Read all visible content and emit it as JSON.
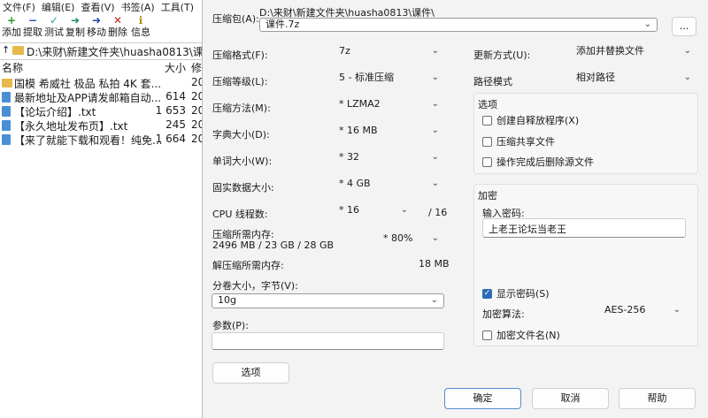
{
  "filemanager": {
    "menu": [
      "文件(F)",
      "编辑(E)",
      "查看(V)",
      "书签(A)",
      "工具(T)"
    ],
    "toolbar": [
      {
        "icon": "+",
        "label": "添加",
        "name": "add"
      },
      {
        "icon": "−",
        "label": "提取",
        "name": "extract"
      },
      {
        "icon": "✓",
        "label": "测试",
        "name": "test"
      },
      {
        "icon": "➜",
        "label": "复制",
        "name": "copy"
      },
      {
        "icon": "➜",
        "label": "移动",
        "name": "move"
      },
      {
        "icon": "✕",
        "label": "删除",
        "name": "delete"
      },
      {
        "icon": "ℹ",
        "label": "信息",
        "name": "info"
      }
    ],
    "path": "D:\\来财\\新建文件夹\\huasha0813\\课件\\",
    "columns": {
      "name": "名称",
      "size": "大小",
      "modified": "修"
    },
    "files": [
      {
        "name": "国模 希威社 极品 私拍 4K 套...",
        "size": "",
        "mod": "20",
        "type": "folder"
      },
      {
        "name": "最新地址及APP请发邮箱自动...",
        "size": "614",
        "mod": "20",
        "type": "file"
      },
      {
        "name": "【论坛介绍】.txt",
        "size": "1 653",
        "mod": "20",
        "type": "file"
      },
      {
        "name": "【永久地址发布页】.txt",
        "size": "245",
        "mod": "20",
        "type": "file"
      },
      {
        "name": "【来了就能下载和观看！纯免...",
        "size": "1 664",
        "mod": "20",
        "type": "file"
      }
    ]
  },
  "dialog": {
    "archive_label": "压缩包(A):",
    "archive_dir": "D:\\来财\\新建文件夹\\huasha0813\\课件\\",
    "archive_name": "课件.7z",
    "browse_label": "...",
    "format_label": "压缩格式(F):",
    "format_value": "7z",
    "level_label": "压缩等级(L):",
    "level_value": "5 - 标准压缩",
    "method_label": "压缩方法(M):",
    "method_value": "*  LZMA2",
    "dict_label": "字典大小(D):",
    "dict_value": "*  16 MB",
    "word_label": "单词大小(W):",
    "word_value": "*  32",
    "solid_label": "固实数据大小:",
    "solid_value": "*  4 GB",
    "threads_label": "CPU 线程数:",
    "threads_value": "*  16",
    "threads_max": "/ 16",
    "mem_comp_label": "压缩所需内存:",
    "mem_comp_value": "2496 MB / 23 GB / 28 GB",
    "mem_percent": "* 80%",
    "mem_decomp_label": "解压缩所需内存:",
    "mem_decomp_value": "18 MB",
    "split_label": "分卷大小，字节(V):",
    "split_value": "10g",
    "params_label": "参数(P):",
    "params_value": "",
    "options_btn": "选项",
    "update_label": "更新方式(U):",
    "update_value": "添加并替换文件",
    "pathmode_label": "路径模式",
    "pathmode_value": "相对路径",
    "options_group": "选项",
    "opt_sfx": "创建自释放程序(X)",
    "opt_shared": "压缩共享文件",
    "opt_delete": "操作完成后删除源文件",
    "encrypt_group": "加密",
    "password_label": "输入密码:",
    "password_value": "上老王论坛当老王",
    "show_password": "显示密码(S)",
    "enc_method_label": "加密算法:",
    "enc_method_value": "AES-256",
    "encrypt_names": "加密文件名(N)",
    "ok": "确定",
    "cancel": "取消",
    "help": "帮助"
  }
}
